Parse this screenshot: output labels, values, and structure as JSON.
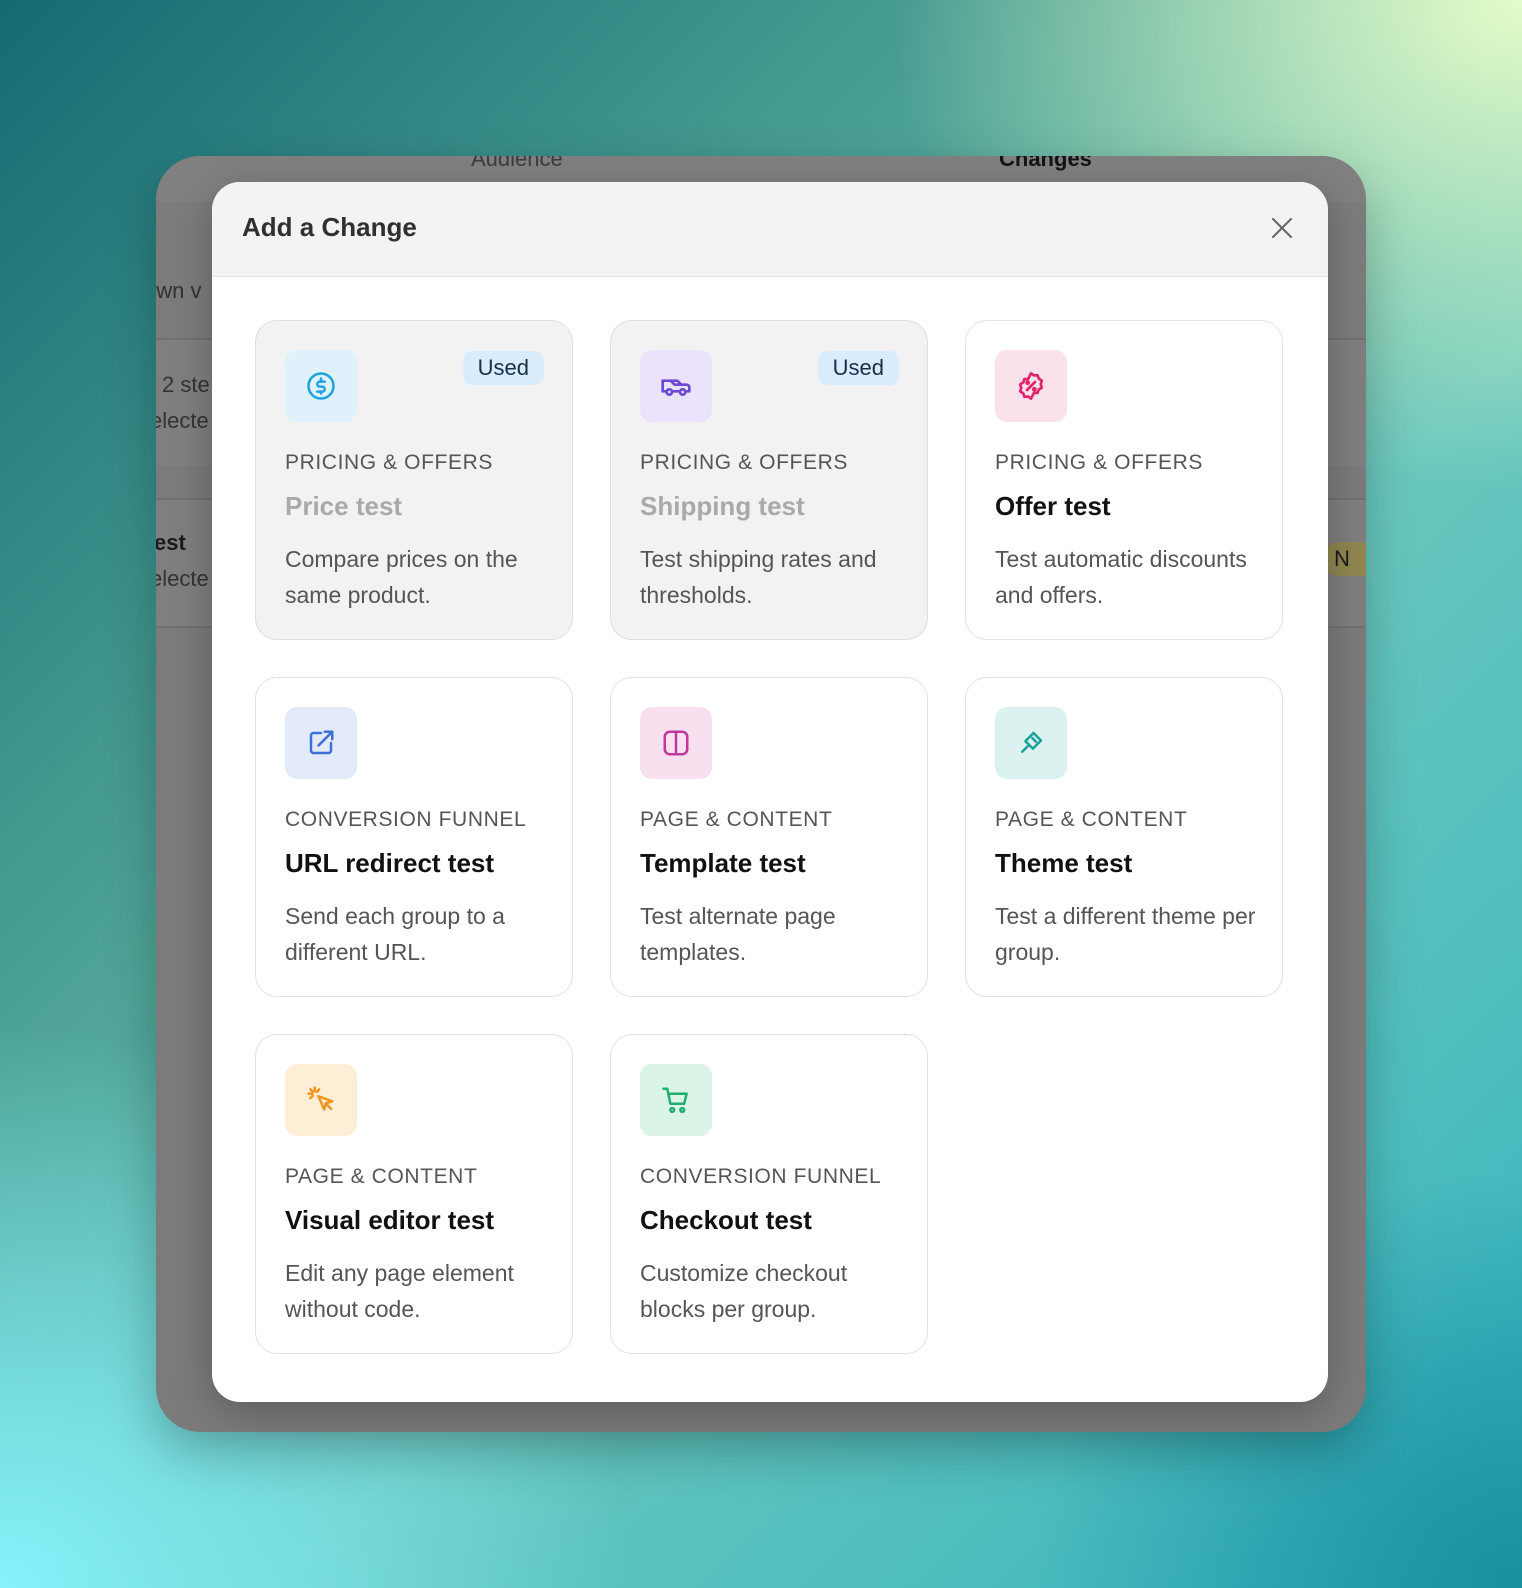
{
  "background_app": {
    "tabs": [
      "Audience",
      "Changes"
    ],
    "fragments": [
      "own v",
      "2 ste",
      "electe",
      "est",
      "electe"
    ],
    "badge": "N"
  },
  "modal": {
    "title": "Add a Change",
    "close_icon": "close-icon",
    "cards": [
      {
        "category": "PRICING & OFFERS",
        "title": "Price test",
        "description": "Compare prices on the same product.",
        "badge": "Used",
        "icon": "dollar-circle-icon",
        "icon_color": "#1fa3e0",
        "icon_bg": "#dff2fb"
      },
      {
        "category": "PRICING & OFFERS",
        "title": "Shipping test",
        "description": "Test shipping rates and thresholds.",
        "badge": "Used",
        "icon": "truck-icon",
        "icon_color": "#6c4ad6",
        "icon_bg": "#ebe3fb"
      },
      {
        "category": "PRICING & OFFERS",
        "title": "Offer test",
        "description": "Test automatic discounts and offers.",
        "badge": "",
        "icon": "discount-badge-icon",
        "icon_color": "#e0246e",
        "icon_bg": "#fbe1ea"
      },
      {
        "category": "CONVERSION FUNNEL",
        "title": "URL redirect test",
        "description": "Send each group to a different URL.",
        "badge": "",
        "icon": "external-link-icon",
        "icon_color": "#3e6ed8",
        "icon_bg": "#e3eaf9"
      },
      {
        "category": "PAGE & CONTENT",
        "title": "Template test",
        "description": "Test alternate page templates.",
        "badge": "",
        "icon": "layout-columns-icon",
        "icon_color": "#c0389e",
        "icon_bg": "#f8e0ef"
      },
      {
        "category": "PAGE & CONTENT",
        "title": "Theme test",
        "description": "Test a different theme per group.",
        "badge": "",
        "icon": "paintbrush-icon",
        "icon_color": "#1aa39a",
        "icon_bg": "#dcf2f1"
      },
      {
        "category": "PAGE & CONTENT",
        "title": "Visual editor test",
        "description": "Edit any page element without code.",
        "badge": "",
        "icon": "cursor-click-icon",
        "icon_color": "#f0951e",
        "icon_bg": "#fdeed5"
      },
      {
        "category": "CONVERSION FUNNEL",
        "title": "Checkout test",
        "description": "Customize checkout blocks per group.",
        "badge": "",
        "icon": "shopping-cart-icon",
        "icon_color": "#1fae6e",
        "icon_bg": "#daf4e8"
      }
    ]
  }
}
